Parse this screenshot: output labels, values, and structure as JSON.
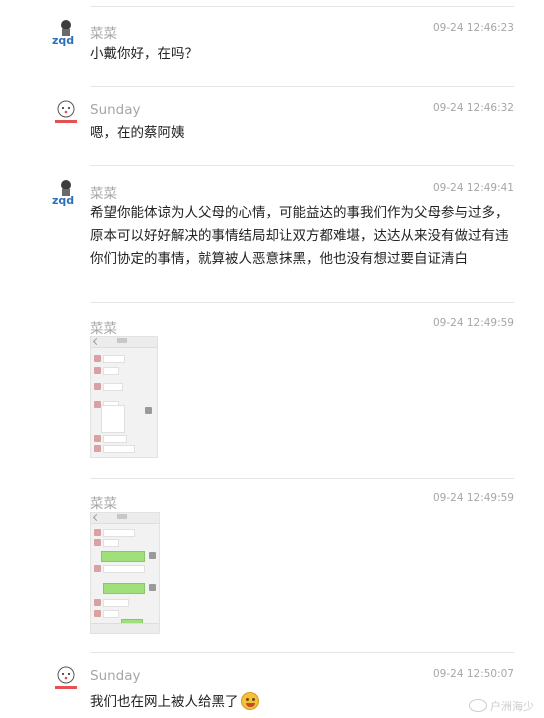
{
  "messages": [
    {
      "sender": "菜菜",
      "time": "09-24 12:46:23",
      "text": "小戴你好，在吗？"
    },
    {
      "sender": "Sunday",
      "time": "09-24 12:46:32",
      "text": "嗯，在的蔡阿姨"
    },
    {
      "sender": "菜菜",
      "time": "09-24 12:49:41",
      "text": "希望你能体谅为人父母的心情，可能益达的事我们作为父母参与过多，原本可以好好解决的事情结局却让双方都难堪，达达从来没有做过有违你们协定的事情，就算被人恶意抹黑，他也没有想过要自证清白"
    },
    {
      "sender": "菜菜",
      "time": "09-24 12:49:59",
      "text": ""
    },
    {
      "sender": "菜菜",
      "time": "09-24 12:49:59",
      "text": ""
    },
    {
      "sender": "Sunday",
      "time": "09-24 12:50:07",
      "text": "我们也在网上被人给黑了"
    }
  ],
  "avatars": {
    "caicai": "zqd-logo-avatar",
    "sunday": "cartoon-bear-avatar"
  },
  "watermark": {
    "icon": "weibo-icon",
    "text": "户洲海少"
  },
  "colors": {
    "text": "#222222",
    "meta": "#a6a6a6",
    "divider": "#e6e6e6",
    "wechat_green": "#9fe07a"
  }
}
